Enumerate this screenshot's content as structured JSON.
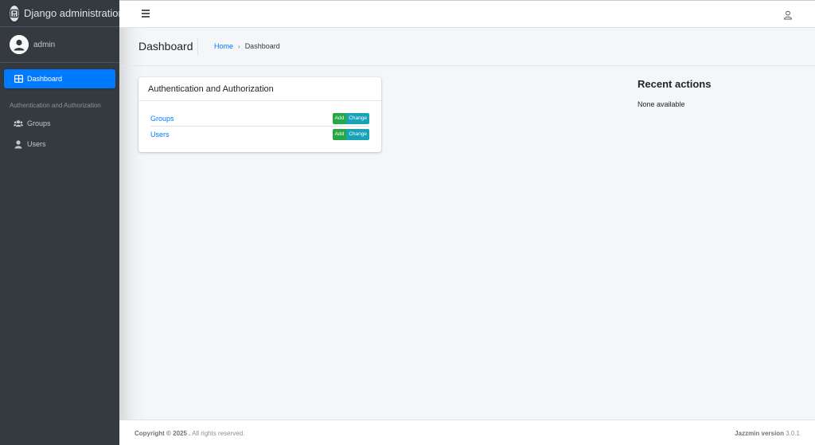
{
  "brand": {
    "title": "Django administration",
    "icon": "django-logo-icon"
  },
  "user": {
    "name": "admin",
    "icon": "user-circle-icon"
  },
  "sidebar": {
    "dashboard_label": "Dashboard",
    "section_header": "Authentication and Authorization",
    "items": [
      {
        "label": "Groups",
        "icon": "users-icon"
      },
      {
        "label": "Users",
        "icon": "user-icon"
      }
    ]
  },
  "topbar": {
    "menu_icon": "hamburger-icon",
    "user_icon": "user-outline-icon"
  },
  "header": {
    "title": "Dashboard",
    "breadcrumb": {
      "home": "Home",
      "separator": "›",
      "current": "Dashboard"
    }
  },
  "app_card": {
    "title": "Authentication and Authorization",
    "models": [
      {
        "name": "Groups",
        "add_label": "Add",
        "change_label": "Change"
      },
      {
        "name": "Users",
        "add_label": "Add",
        "change_label": "Change"
      }
    ]
  },
  "recent_actions": {
    "title": "Recent actions",
    "empty_text": "None available"
  },
  "footer": {
    "copyright_bold": "Copyright © 2025 .",
    "copyright_rest": " All rights reserved.",
    "version_label": "Jazzmin version",
    "version_value": " 3.0.1"
  },
  "colors": {
    "sidebar_bg": "#343a40",
    "accent": "#007bff",
    "add_button": "#28a745",
    "change_button": "#17a2b8"
  }
}
